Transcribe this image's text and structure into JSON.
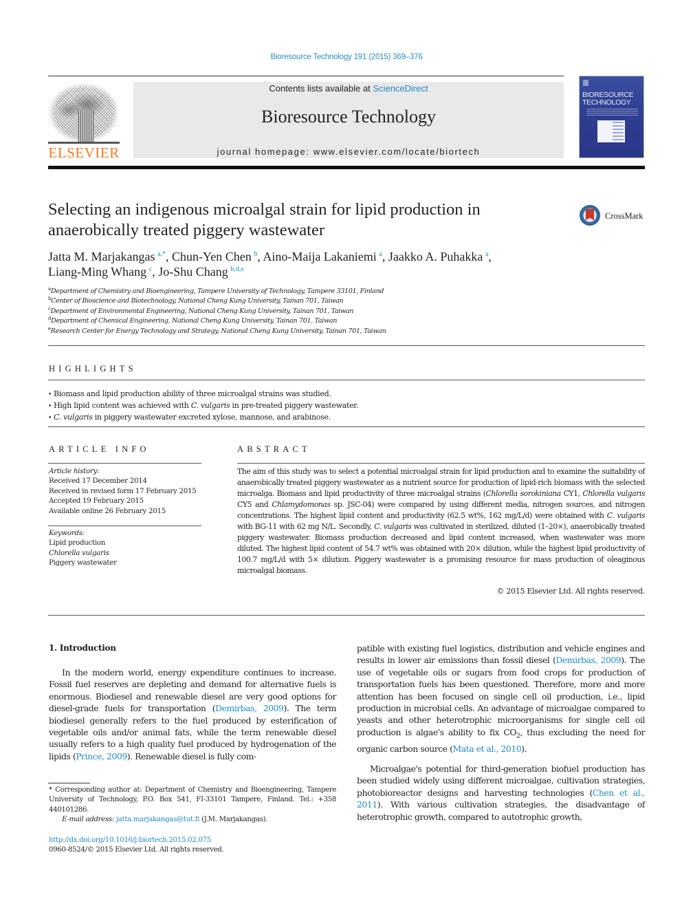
{
  "citation": "Bioresource Technology 191 (2015) 369–376",
  "header": {
    "publisher_logo": "ELSEVIER",
    "contents_prefix": "Contents lists available at ",
    "contents_link": "ScienceDirect",
    "journal_title": "Bioresource Technology",
    "homepage": "journal homepage: www.elsevier.com/locate/biortech",
    "cover_title": "BIORESOURCE TECHNOLOGY",
    "crossmark_label": "CrossMark"
  },
  "article": {
    "title": "Selecting an indigenous microalgal strain for lipid production in anaerobically treated piggery wastewater",
    "authors": [
      {
        "name": "Jatta M. Marjakangas",
        "sup": "a,*"
      },
      {
        "name": "Chun-Yen Chen",
        "sup": "b"
      },
      {
        "name": "Aino-Maija Lakaniemi",
        "sup": "a"
      },
      {
        "name": "Jaakko A. Puhakka",
        "sup": "a"
      },
      {
        "name": "Liang-Ming Whang",
        "sup": "c"
      },
      {
        "name": "Jo-Shu Chang",
        "sup": "b,d,e"
      }
    ],
    "affiliations": [
      {
        "key": "a",
        "text": "Department of Chemistry and Bioengineering, Tampere University of Technology, Tampere 33101, Finland"
      },
      {
        "key": "b",
        "text": "Center of Bioscience and Biotechnology, National Cheng Kung University, Tainan 701, Taiwan"
      },
      {
        "key": "c",
        "text": "Department of Environmental Engineering, National Cheng Kung University, Tainan 701, Taiwan"
      },
      {
        "key": "d",
        "text": "Department of Chemical Engineering, National Cheng Kung University, Tainan 701, Taiwan"
      },
      {
        "key": "e",
        "text": "Research Center for Energy Technology and Strategy, National Cheng Kung University, Tainan 701, Taiwan"
      }
    ]
  },
  "highlights": {
    "heading": "HIGHLIGHTS",
    "items": [
      {
        "pre": "Biomass and lipid production ability of three microalgal strains was studied.",
        "em": "",
        "post": ""
      },
      {
        "pre": "High lipid content was achieved with ",
        "em": "C. vulgaris",
        "post": " in pre-treated piggery wastewater."
      },
      {
        "pre": "",
        "em": "C. vulgaris",
        "post": " in piggery wastewater excreted xylose, mannose, and arabinose."
      }
    ]
  },
  "article_info": {
    "heading": "ARTICLE INFO",
    "history_label": "Article history:",
    "history": [
      "Received 17 December 2014",
      "Received in revised form 17 February 2015",
      "Accepted 19 February 2015",
      "Available online 26 February 2015"
    ],
    "keywords_label": "Keywords:",
    "keywords": [
      "Lipid production",
      "Chlorella vulgaris",
      "Piggery wastewater"
    ]
  },
  "abstract": {
    "heading": "ABSTRACT",
    "p1": "The aim of this study was to select a potential microalgal strain for lipid production and to examine the suitability of anaerobically treated piggery wastewater as a nutrient source for production of lipid-rich biomass with the selected microalga. Biomass and lipid productivity of three microalgal strains (",
    "sp1": "Chlorella sorokiniana",
    "p2": " CY1, ",
    "sp2": "Chlorella vulgaris",
    "p3": " CY5 and ",
    "sp3": "Chlamydomonas",
    "p4": " sp. JSC-04) were compared by using different media, nitrogen sources, and nitrogen concentrations. The highest lipid content and productivity (62.5 wt%, 162 mg/L/d) were obtained with ",
    "sp4": "C. vulgaris",
    "p5": " with BG-11 with 62 mg N/L. Secondly, ",
    "sp5": "C. vulgaris",
    "p6": " was cultivated in sterilized, diluted (1–20×), anaerobically treated piggery wastewater. Biomass production decreased and lipid content increased, when wastewater was more diluted. The highest lipid content of 54.7 wt% was obtained with 20× dilution, while the highest lipid productivity of 100.7 mg/L/d with 5× dilution. Piggery wastewater is a promising resource for mass production of oleaginous microalgal biomass.",
    "copyright": "© 2015 Elsevier Ltd. All rights reserved."
  },
  "introduction": {
    "heading": "1. Introduction",
    "col1": [
      {
        "t": "In the modern world, energy expenditure continues to increase. Fossil fuel reserves are depleting and demand for alternative fuels is enormous. Biodiesel and renewable diesel are very good options for diesel-grade fuels for transportation ("
      },
      {
        "link": "Demirbas, 2009"
      },
      {
        "t": "). The term biodiesel generally refers to the fuel produced by esterification of vegetable oils and/or animal fats, while the term renewable diesel usually refers to a high quality fuel produced by hydrogenation of the lipids ("
      },
      {
        "link": "Prince, 2009"
      },
      {
        "t": "). Renewable diesel is fully com-"
      }
    ],
    "col2a": [
      {
        "t": "patible with existing fuel logistics, distribution and vehicle engines and results in lower air emissions than fossil diesel ("
      },
      {
        "link": "Demirbas, 2009"
      },
      {
        "t": "). The use of vegetable oils or sugars from food crops for production of transportation fuels has been questioned. Therefore, more and more attention has been focused on single cell oil production, i.e., lipid production in microbial cells. An advantage of microalgae compared to yeasts and other heterotrophic microorganisms for single cell oil production is algae's ability to fix CO"
      },
      {
        "sub": "2"
      },
      {
        "t": ", thus excluding the need for organic carbon source ("
      },
      {
        "link": "Mata et al., 2010"
      },
      {
        "t": ")."
      }
    ],
    "col2b": [
      {
        "t": "Microalgae's potential for third-generation biofuel production has been studied widely using different microalgae, cultivation strategies, photobioreactor designs and harvesting technologies ("
      },
      {
        "link": "Chen et al., 2011"
      },
      {
        "t": "). With various cultivation strategies, the disadvantage of heterotrophic growth, compared to autotrophic growth,"
      }
    ]
  },
  "footnote": {
    "corresponding": "* Corresponding author at: Department of Chemistry and Bioengineering, Tampere University of Technology, P.O. Box 541, FI-33101 Tampere, Finland. Tel.: +358 440101286.",
    "email_label": "E-mail address: ",
    "email": "jatta.marjakangas@tut.fi",
    "email_suffix": " (J.M. Marjakangas).",
    "doi": "http://dx.doi.org/10.1016/j.biortech.2015.02.075",
    "issn": "0960-8524/© 2015 Elsevier Ltd. All rights reserved."
  }
}
